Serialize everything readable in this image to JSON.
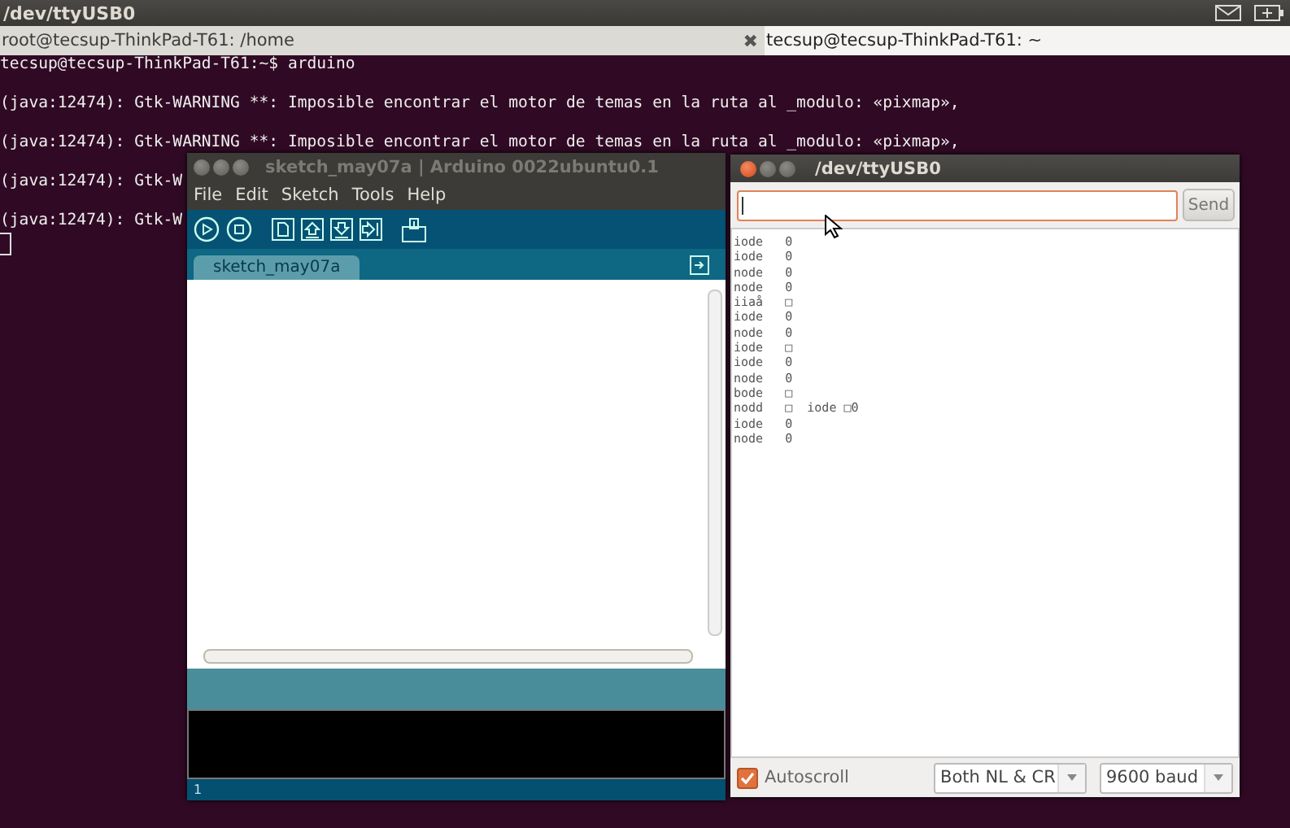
{
  "top_panel": {
    "title": "/dev/ttyUSB0"
  },
  "terminal": {
    "tabs": [
      {
        "label": "root@tecsup-ThinkPad-T61: /home",
        "selected": false,
        "close": "✖"
      },
      {
        "label": "tecsup@tecsup-ThinkPad-T61: ~",
        "selected": true
      }
    ],
    "lines": [
      "tecsup@tecsup-ThinkPad-T61:~$ arduino",
      "(java:12474): Gtk-WARNING **: Imposible encontrar el motor de temas en la ruta al _modulo: «pixmap»,",
      "(java:12474): Gtk-WARNING **: Imposible encontrar el motor de temas en la ruta al _modulo: «pixmap»,",
      "(java:12474): Gtk-W",
      "(java:12474): Gtk-W"
    ]
  },
  "arduino": {
    "title": "sketch_may07a | Arduino 0022ubuntu0.1",
    "menu": [
      "File",
      "Edit",
      "Sketch",
      "Tools",
      "Help"
    ],
    "tabs": [
      {
        "label": "sketch_may07a",
        "selected": true
      }
    ],
    "status_line": "1"
  },
  "serial_monitor": {
    "title": "/dev/ttyUSB0",
    "send": "Send",
    "output": [
      "iode   0",
      "iode   0",
      "node   0",
      "node   0",
      "iiaå   □",
      "iode   0",
      "node   0",
      "iode   □",
      "iode   0",
      "node   0",
      "bode   □",
      "nodd   □  iode □0",
      "iode   0",
      "node   0"
    ],
    "autoscroll": {
      "label": "Autoscroll",
      "checked": true
    },
    "line_ending": "Both NL & CR",
    "baud": "9600 baud"
  }
}
